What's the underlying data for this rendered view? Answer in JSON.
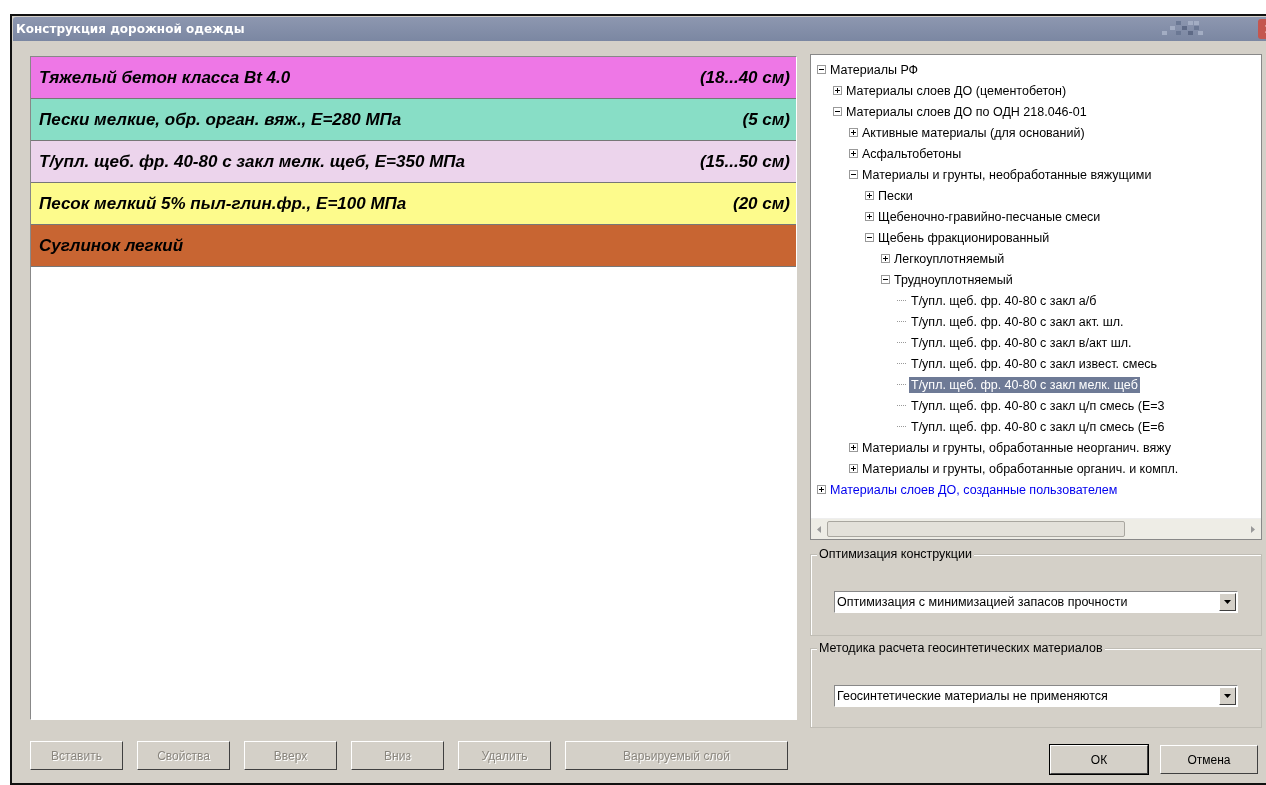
{
  "window": {
    "title": "Конструкция дорожной одежды"
  },
  "layers": [
    {
      "name": "Тяжелый бетон класса Bt 4.0",
      "thickness": "(18...40 см)",
      "color": "#ee77e6"
    },
    {
      "name": "Пески мелкие, обр. орган. вяж., Е=280 МПа",
      "thickness": "(5 см)",
      "color": "#88dec6"
    },
    {
      "name": "Т/упл. щеб. фр. 40-80 с закл мелк. щеб, Е=350 МПа",
      "thickness": "(15...50 см)",
      "color": "#ecd4ec"
    },
    {
      "name": "Песок мелкий 5% пыл-глин.фр., Е=100 МПа",
      "thickness": "(20 см)",
      "color": "#fdfb8c"
    },
    {
      "name": "Суглинок легкий",
      "color": "#c86532"
    }
  ],
  "tree": [
    {
      "label": "Материалы РФ",
      "kind": "builtin",
      "expanded": true,
      "selected": false,
      "children": [
        {
          "label": "Материалы слоев ДО (цементобетон)",
          "kind": "builtin",
          "expanded": false,
          "selected": false
        },
        {
          "label": "Материалы слоев ДО по ОДН 218.046-01",
          "kind": "builtin",
          "expanded": true,
          "selected": false,
          "children": [
            {
              "label": "Активные материалы (для оснований)",
              "kind": "builtin",
              "expanded": false,
              "selected": false
            },
            {
              "label": "Асфальтобетоны",
              "kind": "builtin",
              "expanded": false,
              "selected": false
            },
            {
              "label": "Материалы и грунты, необработанные вяжущими",
              "kind": "builtin",
              "expanded": true,
              "selected": false,
              "children": [
                {
                  "label": "Пески",
                  "kind": "builtin",
                  "expanded": false,
                  "selected": false
                },
                {
                  "label": "Щебеночно-гравийно-песчаные смеси",
                  "kind": "builtin",
                  "expanded": false,
                  "selected": false
                },
                {
                  "label": "Щебень фракционированный",
                  "kind": "builtin",
                  "expanded": true,
                  "selected": false,
                  "children": [
                    {
                      "label": "Легкоуплотняемый",
                      "kind": "builtin",
                      "expanded": false,
                      "selected": false
                    },
                    {
                      "label": "Трудноуплотняемый",
                      "kind": "builtin",
                      "expanded": true,
                      "selected": false,
                      "children": [
                        {
                          "label": "Т/упл. щеб. фр. 40-80 с закл а/б",
                          "kind": "builtin",
                          "selected": false
                        },
                        {
                          "label": "Т/упл. щеб. фр. 40-80 с закл акт. шл.",
                          "kind": "builtin",
                          "selected": false
                        },
                        {
                          "label": "Т/упл. щеб. фр. 40-80 с закл в/акт шл.",
                          "kind": "builtin",
                          "selected": false
                        },
                        {
                          "label": "Т/упл. щеб. фр. 40-80 с закл извест. смесь",
                          "kind": "builtin",
                          "selected": false
                        },
                        {
                          "label": "Т/упл. щеб. фр. 40-80 с закл мелк. щеб",
                          "kind": "builtin",
                          "selected": true
                        },
                        {
                          "label": "Т/упл. щеб. фр. 40-80 с закл ц/п смесь (Е=3",
                          "kind": "builtin",
                          "selected": false
                        },
                        {
                          "label": "Т/упл. щеб. фр. 40-80 с закл ц/п смесь (Е=6",
                          "kind": "builtin",
                          "selected": false
                        }
                      ]
                    }
                  ]
                }
              ]
            },
            {
              "label": "Материалы и грунты, обработанные неорганич. вяжу",
              "kind": "builtin",
              "expanded": false,
              "selected": false
            },
            {
              "label": "Материалы и грунты, обработанные органич. и компл.",
              "kind": "builtin",
              "expanded": false,
              "selected": false
            }
          ]
        }
      ]
    },
    {
      "label": "Материалы слоев ДО, созданные пользователем",
      "kind": "user",
      "expanded": false,
      "selected": false
    }
  ],
  "optimization": {
    "title": "Оптимизация конструкции",
    "value": "Оптимизация с минимизацией запасов прочности"
  },
  "geosynthetics": {
    "title": "Методика расчета геосинтетических материалов",
    "value": "Геосинтетические материалы не применяются"
  },
  "layer_buttons": [
    {
      "label": "Вставить",
      "disabled": true
    },
    {
      "label": "Свойства",
      "disabled": true
    },
    {
      "label": "Вверх",
      "disabled": true
    },
    {
      "label": "Вниз",
      "disabled": true
    },
    {
      "label": "Удалить",
      "disabled": true
    },
    {
      "label": "Варьируемый слой",
      "disabled": true
    }
  ],
  "dialog_buttons": [
    {
      "label": "ОК",
      "disabled": false,
      "default": true
    },
    {
      "label": "Отмена",
      "disabled": false,
      "default": false
    }
  ]
}
